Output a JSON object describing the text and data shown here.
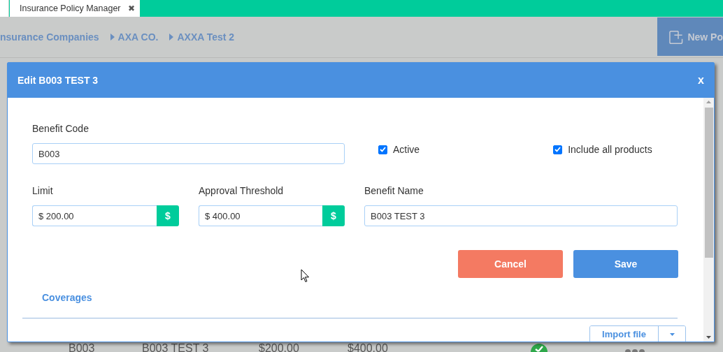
{
  "app_tab": {
    "label": "Insurance Policy Manager",
    "close": "✖",
    "selected": true
  },
  "breadcrumbs": [
    {
      "label": "nsurance Companies"
    },
    {
      "label": "AXA CO."
    },
    {
      "label": "AXXA Test 2"
    }
  ],
  "new_button": {
    "label": "New Po"
  },
  "background_row": {
    "cells": [
      "B003",
      "B003 TEST 3",
      "$200.00",
      "$400.00"
    ],
    "active": true
  },
  "dialog": {
    "title": "Edit B003 TEST 3",
    "close": "x",
    "benefit_code": {
      "label": "Benefit Code",
      "value": "B003"
    },
    "checkboxes": [
      {
        "label": "Active",
        "checked": true
      },
      {
        "label": "Include all products",
        "checked": true
      }
    ],
    "money_fields": [
      {
        "label": "Limit",
        "value": "$ 200.00",
        "addon": "$"
      },
      {
        "label": "Approval Threshold",
        "value": "$ 400.00",
        "addon": "$"
      }
    ],
    "benefit_name": {
      "label": "Benefit Name",
      "value": "B003 TEST 3"
    },
    "buttons": [
      {
        "kind": "cancel",
        "label": "Cancel"
      },
      {
        "kind": "save",
        "label": "Save"
      }
    ],
    "section_tab": {
      "label": "Coverages",
      "selected": true
    },
    "import_button": {
      "label": "Import file"
    }
  }
}
